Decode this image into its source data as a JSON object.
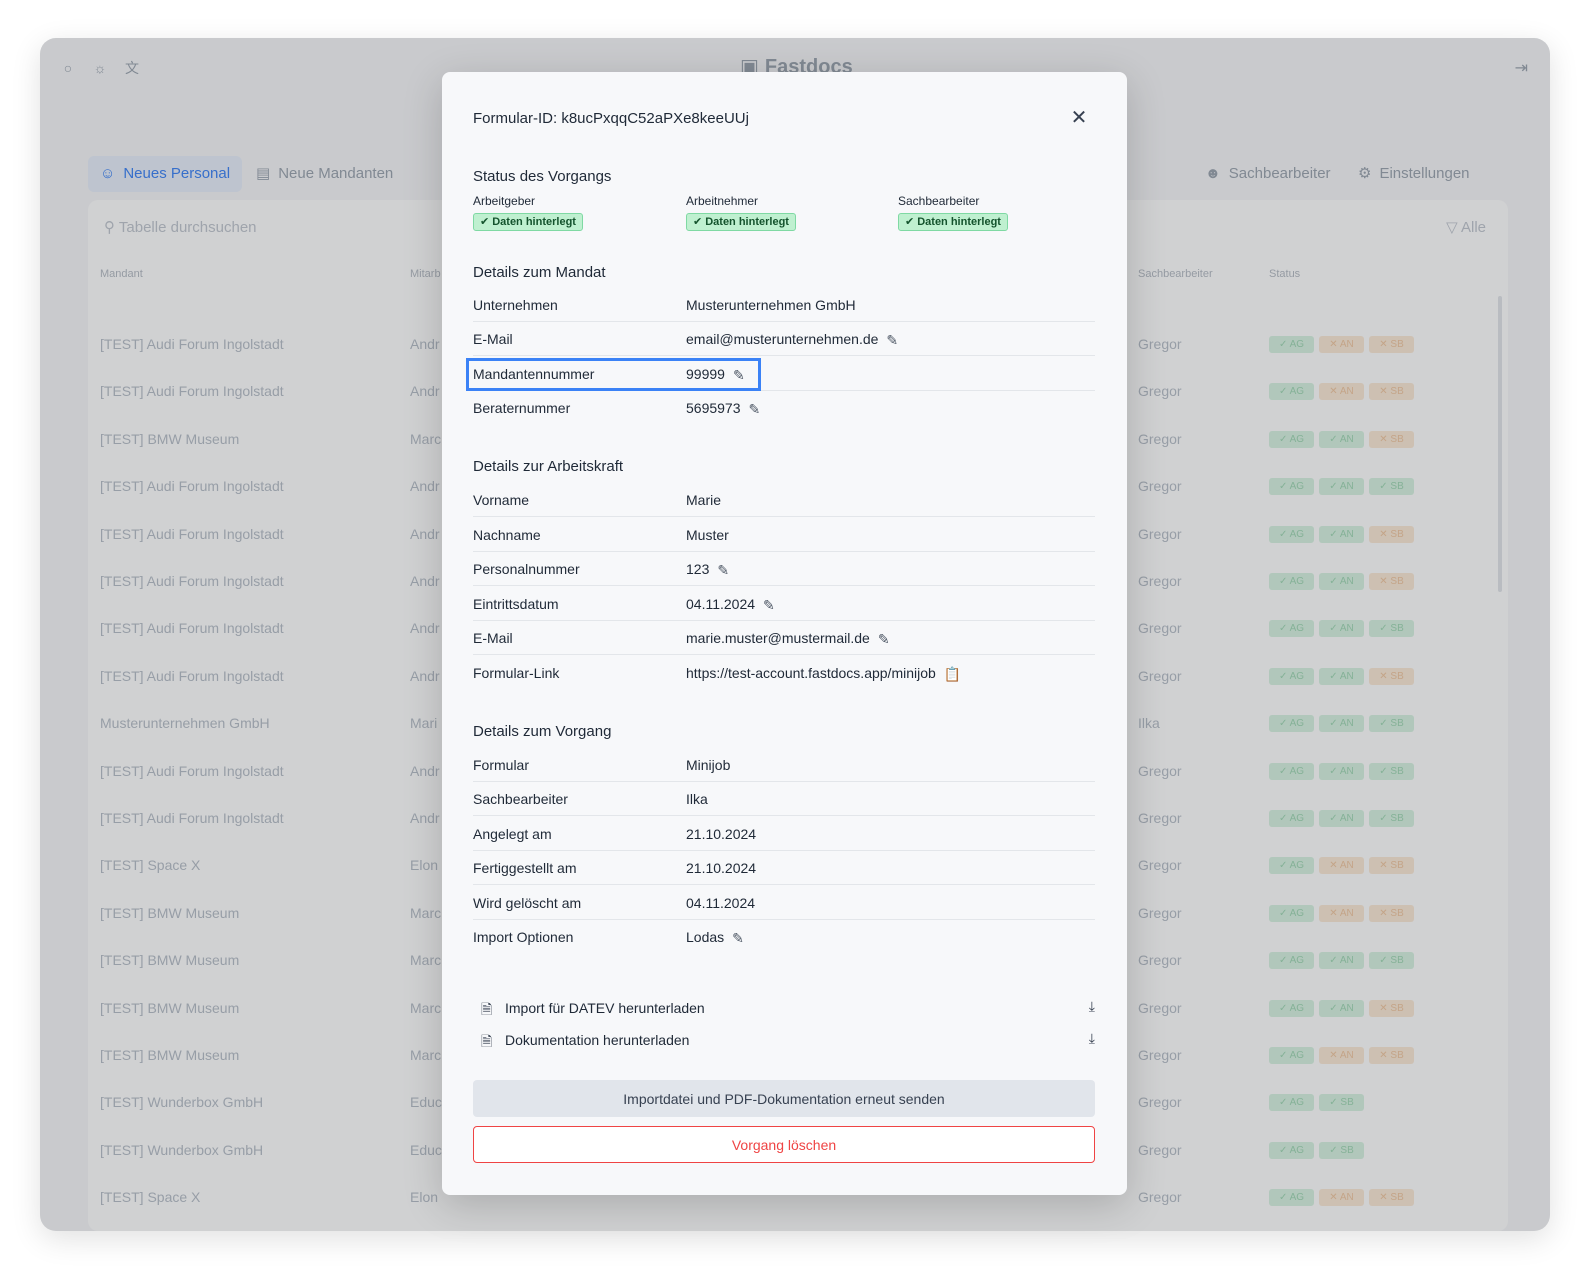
{
  "app": {
    "logo": "Fastdocs",
    "tabs": [
      "Neues Personal",
      "Neue Mandanten",
      "Sachbearbeiter",
      "Einstellungen"
    ],
    "search_placeholder": "Tabelle durchsuchen",
    "filter_label": "Alle",
    "columns": [
      "Mandant",
      "Mitarb",
      "Sachbearbeiter",
      "Status"
    ],
    "rows": [
      {
        "mandant": "[TEST] Audi Forum Ingolstadt",
        "mitarb": "Andr",
        "sb": "Gregor",
        "status": [
          "ok",
          "no",
          "no"
        ]
      },
      {
        "mandant": "[TEST] Audi Forum Ingolstadt",
        "mitarb": "Andr",
        "sb": "Gregor",
        "status": [
          "ok",
          "no",
          "no"
        ]
      },
      {
        "mandant": "[TEST] BMW Museum",
        "mitarb": "Marc",
        "sb": "Gregor",
        "status": [
          "ok",
          "ok",
          "no"
        ]
      },
      {
        "mandant": "[TEST] Audi Forum Ingolstadt",
        "mitarb": "Andr",
        "sb": "Gregor",
        "status": [
          "ok",
          "ok",
          "ok"
        ]
      },
      {
        "mandant": "[TEST] Audi Forum Ingolstadt",
        "mitarb": "Andr",
        "sb": "Gregor",
        "status": [
          "ok",
          "ok",
          "no"
        ]
      },
      {
        "mandant": "[TEST] Audi Forum Ingolstadt",
        "mitarb": "Andr",
        "sb": "Gregor",
        "status": [
          "ok",
          "ok",
          "no"
        ]
      },
      {
        "mandant": "[TEST] Audi Forum Ingolstadt",
        "mitarb": "Andr",
        "sb": "Gregor",
        "status": [
          "ok",
          "ok",
          "ok"
        ]
      },
      {
        "mandant": "[TEST] Audi Forum Ingolstadt",
        "mitarb": "Andr",
        "sb": "Gregor",
        "status": [
          "ok",
          "ok",
          "no"
        ]
      },
      {
        "mandant": "Musterunternehmen GmbH",
        "mitarb": "Mari",
        "sb": "Ilka",
        "status": [
          "ok",
          "ok",
          "ok"
        ]
      },
      {
        "mandant": "[TEST] Audi Forum Ingolstadt",
        "mitarb": "Andr",
        "sb": "Gregor",
        "status": [
          "ok",
          "ok",
          "ok"
        ]
      },
      {
        "mandant": "[TEST] Audi Forum Ingolstadt",
        "mitarb": "Andr",
        "sb": "Gregor",
        "status": [
          "ok",
          "ok",
          "ok"
        ]
      },
      {
        "mandant": "[TEST] Space X",
        "mitarb": "Elon",
        "sb": "Gregor",
        "status": [
          "ok",
          "no",
          "no"
        ]
      },
      {
        "mandant": "[TEST] BMW Museum",
        "mitarb": "Marc",
        "sb": "Gregor",
        "status": [
          "ok",
          "no",
          "no"
        ]
      },
      {
        "mandant": "[TEST] BMW Museum",
        "mitarb": "Marc",
        "sb": "Gregor",
        "status": [
          "ok",
          "ok",
          "ok"
        ]
      },
      {
        "mandant": "[TEST] BMW Museum",
        "mitarb": "Marc",
        "sb": "Gregor",
        "status": [
          "ok",
          "ok",
          "no"
        ]
      },
      {
        "mandant": "[TEST] BMW Museum",
        "mitarb": "Marc",
        "sb": "Gregor",
        "status": [
          "ok",
          "no",
          "no"
        ]
      },
      {
        "mandant": "[TEST] Wunderbox GmbH",
        "mitarb": "Educ",
        "sb": "Gregor",
        "status": [
          "ok",
          "ok"
        ]
      },
      {
        "mandant": "[TEST] Wunderbox GmbH",
        "mitarb": "Educ",
        "sb": "Gregor",
        "status": [
          "ok",
          "ok"
        ]
      },
      {
        "mandant": "[TEST] Space X",
        "mitarb": "Elon",
        "sb": "Gregor",
        "status": [
          "ok",
          "no",
          "no"
        ]
      }
    ]
  },
  "modal": {
    "title": "Formular-ID: k8ucPxqqC52aPXe8keeUUj",
    "close_icon": "close-icon",
    "status": {
      "heading": "Status des Vorgangs",
      "columns": [
        {
          "label": "Arbeitgeber",
          "badge": "Daten hinterlegt"
        },
        {
          "label": "Arbeitnehmer",
          "badge": "Daten hinterlegt"
        },
        {
          "label": "Sachbearbeiter",
          "badge": "Daten hinterlegt"
        }
      ]
    },
    "mandat": {
      "heading": "Details zum Mandat",
      "rows": [
        {
          "key": "Unternehmen",
          "value": "Musterunternehmen GmbH"
        },
        {
          "key": "E-Mail",
          "value": "email@musterunternehmen.de"
        },
        {
          "key": "Mandantennummer",
          "value": "99999"
        },
        {
          "key": "Beraternummer",
          "value": "5695973"
        }
      ]
    },
    "arbeitskraft": {
      "heading": "Details zur Arbeitskraft",
      "rows": [
        {
          "key": "Vorname",
          "value": "Marie"
        },
        {
          "key": "Nachname",
          "value": "Muster"
        },
        {
          "key": "Personalnummer",
          "value": "123"
        },
        {
          "key": "Eintrittsdatum",
          "value": "04.11.2024"
        },
        {
          "key": "E-Mail",
          "value": "marie.muster@mustermail.de"
        },
        {
          "key": "Formular-Link",
          "value": "https://test-account.fastdocs.app/minijob"
        }
      ]
    },
    "vorgang": {
      "heading": "Details zum Vorgang",
      "rows": [
        {
          "key": "Formular",
          "value": "Minijob"
        },
        {
          "key": "Sachbearbeiter",
          "value": "Ilka"
        },
        {
          "key": "Angelegt am",
          "value": "21.10.2024"
        },
        {
          "key": "Fertiggestellt am",
          "value": "21.10.2024"
        },
        {
          "key": "Wird gelöscht am",
          "value": "04.11.2024"
        },
        {
          "key": "Import Optionen",
          "value": "Lodas"
        }
      ]
    },
    "downloads": [
      {
        "label": "Import für DATEV herunterladen",
        "icon": "file-icon"
      },
      {
        "label": "Dokumentation herunterladen",
        "icon": "pdf-icon"
      }
    ],
    "send_button": "Importdatei und PDF-Dokumentation erneut senden",
    "delete_button": "Vorgang löschen",
    "colors": {
      "accent": "#3b82f6",
      "danger": "#ef4444",
      "success_bg": "#bff0d0"
    }
  }
}
